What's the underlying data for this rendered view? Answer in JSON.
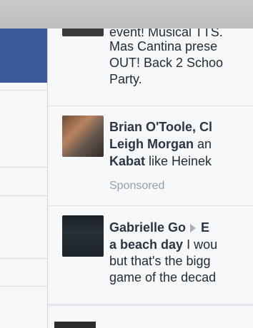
{
  "feed": {
    "story1": {
      "lines": [
        "event! Musical TTS.",
        "Mas Cantina prese",
        "OUT! Back 2 Schoo",
        "Party."
      ]
    },
    "story2": {
      "line1_name": "Brian O'Toole, Cl",
      "line2_name": "Leigh Morgan",
      "line2_rest": " an",
      "line3_name": "Kabat",
      "line3_rest": " like Heinek",
      "sponsored": "Sponsored"
    },
    "story3": {
      "name": "Gabrielle Go",
      "target": "E",
      "line2": "a beach day",
      "line2_rest": " I wou",
      "line3": "but that's the bigg",
      "line4": "game of the decad"
    }
  }
}
